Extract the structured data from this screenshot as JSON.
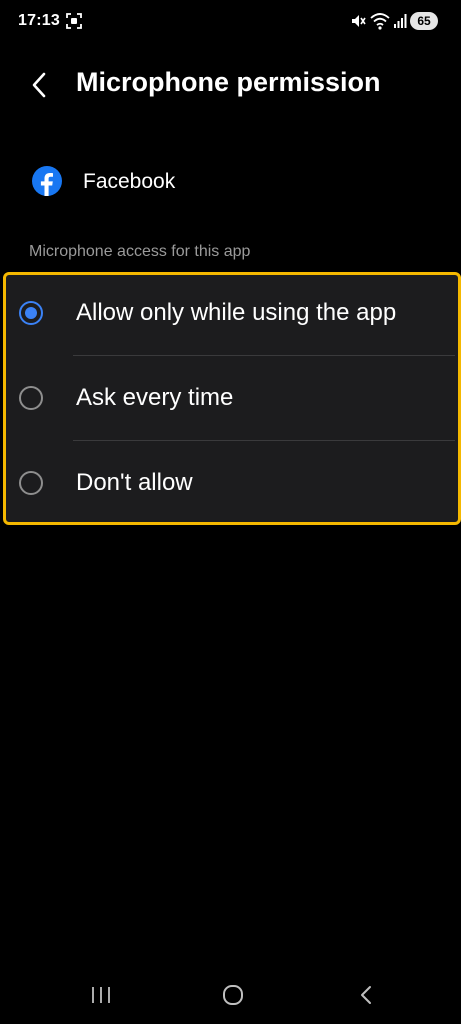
{
  "status_bar": {
    "time": "17:13",
    "battery": "65",
    "icons": [
      "screen-record-icon",
      "mute-icon",
      "wifi-icon",
      "signal-icon",
      "battery-icon"
    ]
  },
  "header": {
    "back_icon": "chevron-left-icon",
    "title": "Microphone permission"
  },
  "app": {
    "name": "Facebook",
    "icon": "facebook-icon",
    "brand_color": "#1877f2"
  },
  "section": {
    "label": "Microphone access for this app"
  },
  "options": [
    {
      "label": "Allow only while using the app",
      "selected": true
    },
    {
      "label": "Ask every time",
      "selected": false
    },
    {
      "label": "Don't allow",
      "selected": false
    }
  ],
  "colors": {
    "background": "#000000",
    "card": "#1c1c1e",
    "highlight_border": "#f5b800",
    "radio_selected": "#3b82f6",
    "radio_unselected": "#8e8e8e",
    "section_label": "#9a9a9a"
  },
  "nav_bar": {
    "icons": [
      "recents-icon",
      "home-icon",
      "back-icon"
    ]
  }
}
